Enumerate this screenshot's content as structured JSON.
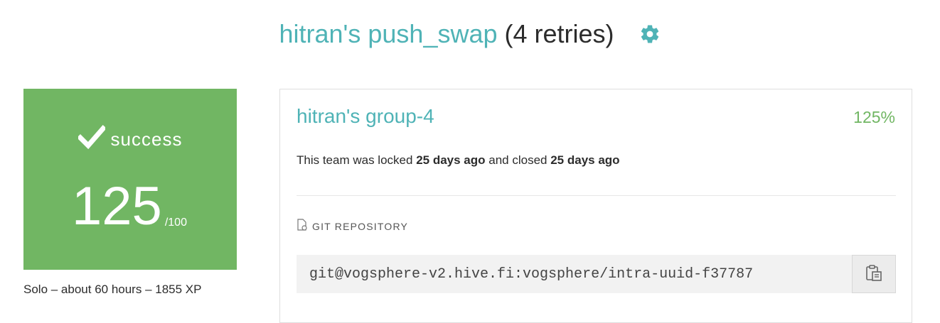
{
  "header": {
    "project_title": "hitran's push_swap",
    "retries": "(4 retries)",
    "settings_icon": "gear-icon"
  },
  "grade": {
    "status": "success",
    "status_icon": "check-icon",
    "score": "125",
    "max": "/100",
    "background_color": "#71b663"
  },
  "meta": {
    "summary": "Solo – about 60 hours – 1855 XP"
  },
  "team": {
    "name": "hitran's group-4",
    "grade": "125%",
    "status_prefix": "This team was locked",
    "locked_time": "25 days ago",
    "status_middle": "and closed",
    "closed_time": "25 days ago"
  },
  "repository": {
    "label": "GIT REPOSITORY",
    "label_icon": "file-icon",
    "url": "git@vogsphere-v2.hive.fi:vogsphere/intra-uuid-f37787",
    "copy_icon": "clipboard-icon"
  },
  "colors": {
    "accent_teal": "#4fb3b6",
    "success_green": "#71b663"
  }
}
